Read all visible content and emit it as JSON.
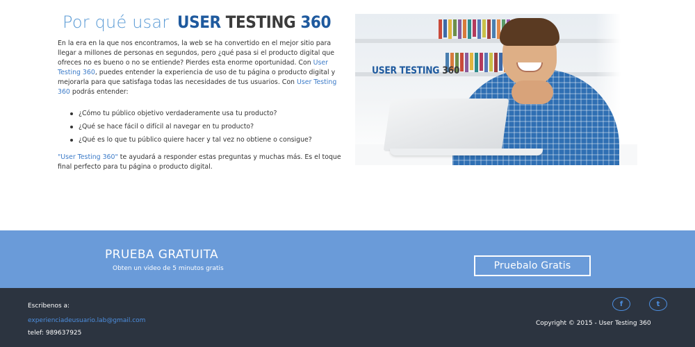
{
  "intro": {
    "headline_prefix": "Por qué usar",
    "headline_brand_part1": "USER",
    "headline_brand_part2": "TESTING",
    "headline_brand_part3": "360",
    "para_part1": "En la era en la que nos encontramos, la web se ha convertido en el mejor sitio para llegar a millones de personas en segundos, pero ¿qué pasa si el producto digital que ofreces no es bueno o no se entiende? Pierdes esta enorme oportunidad. Con ",
    "para_link1": "User Testing 360",
    "para_part2": ", puedes entender la experiencia de uso de tu página o producto digital y mejorarla para que satisfaga todas las necesidades de tus usuarios. Con ",
    "para_link2": "User Testing 360",
    "para_part3": " podrás entender:",
    "bullets": [
      "¿Cómo tu público objetivo verdaderamente usa tu producto?",
      "¿Qué se hace fácil o difícil al navegar en tu producto?",
      "¿Qué es lo que tu público quiere hacer y tal vez no obtiene o consigue?"
    ],
    "closing_link": "\"User Testing 360\"",
    "closing_text": " te ayudará a responder estas preguntas y muchas más. Es el toque final perfecto para tu página o producto digital."
  },
  "hero": {
    "logo_part1": "USER TESTING",
    "logo_part2": "360"
  },
  "cta": {
    "title": "PRUEBA GRATUITA",
    "subtitle": "Obten un video de 5 minutos gratis",
    "button_label": "Pruebalo Gratis"
  },
  "footer": {
    "contact_label": "Escribenos a:",
    "email": "experienciadeusuario.lab@gmail.com",
    "phone": "telef: 989637925",
    "facebook_glyph": "f",
    "twitter_glyph": "t",
    "copyright": "Copyright © 2015 - User Testing 360"
  },
  "colors": {
    "accent_blue": "#5b9bd5",
    "brand_dark_blue": "#1f5a9e",
    "cta_band": "#6a9bd9",
    "footer_bg": "#2c3440",
    "link_blue": "#4d8fe0"
  },
  "icons": {
    "facebook": "facebook-icon",
    "twitter": "twitter-icon"
  }
}
